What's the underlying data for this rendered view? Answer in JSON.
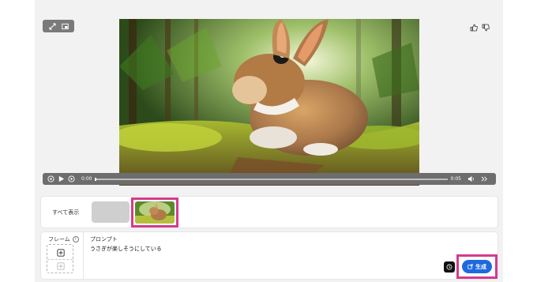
{
  "toolbar": {
    "expand_icon": "expand-icon",
    "pip_icon": "picture-in-picture-icon"
  },
  "feedback": {
    "like_icon": "thumbs-up-icon",
    "dislike_icon": "thumbs-down-icon"
  },
  "player": {
    "current_time": "0:00",
    "duration": "0:05",
    "progress": 0.0
  },
  "strip": {
    "show_all_label": "すべて表示"
  },
  "prompt_panel": {
    "frame_label": "フレーム",
    "prompt_label": "プロンプト",
    "prompt_value": "うさぎが楽しそうにしている",
    "generate_label": "生成"
  },
  "colors": {
    "highlight": "#d63a8c",
    "primary": "#1d6ae0"
  }
}
